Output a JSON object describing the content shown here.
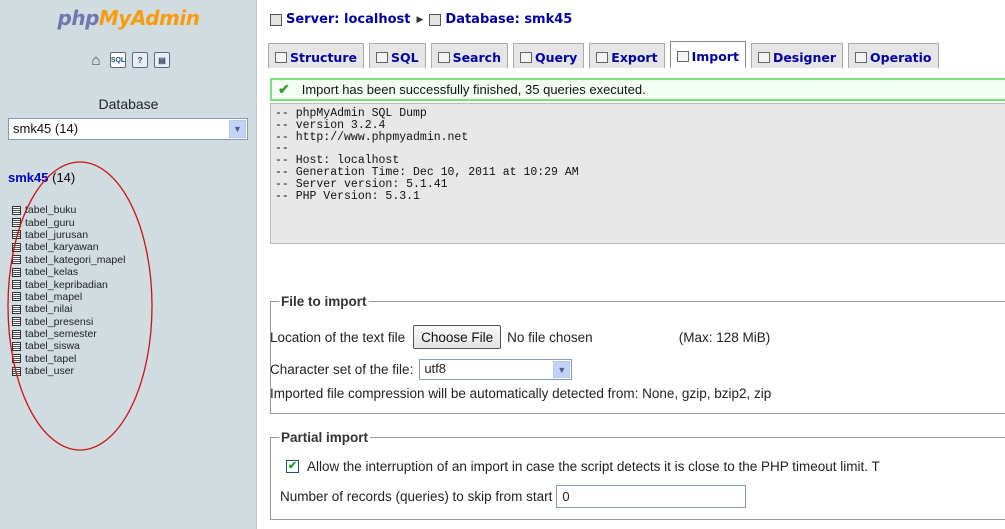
{
  "logo": {
    "part1": "php",
    "part2": "MyAdmin"
  },
  "left": {
    "quick_icons": [
      "home-icon",
      "sql-query-icon",
      "docs-icon",
      "sql-docs-icon"
    ],
    "database_label": "Database",
    "database_select": "smk45 (14)",
    "db_name": "smk45",
    "db_count": "(14)",
    "tables": [
      "tabel_buku",
      "tabel_guru",
      "tabel_jurusan",
      "tabel_karyawan",
      "tabel_kategori_mapel",
      "tabel_kelas",
      "tabel_kepribadian",
      "tabel_mapel",
      "tabel_nilai",
      "tabel_presensi",
      "tabel_semester",
      "tabel_siswa",
      "tabel_tapel",
      "tabel_user"
    ]
  },
  "breadcrumb": {
    "server": "Server: localhost",
    "database": "Database: smk45"
  },
  "tabs": [
    "Structure",
    "SQL",
    "Search",
    "Query",
    "Export",
    "Import",
    "Designer",
    "Operatio"
  ],
  "active_tab": "Import",
  "success_message": "Import has been successfully finished, 35 queries executed.",
  "sql_dump": [
    "-- phpMyAdmin SQL Dump",
    "-- version 3.2.4",
    "-- http://www.phpmyadmin.net",
    "--",
    "-- Host: localhost",
    "-- Generation Time: Dec 10, 2011 at 10:29 AM",
    "-- Server version: 5.1.41",
    "-- PHP Version: 5.3.1"
  ],
  "file_import": {
    "legend": "File to import",
    "location_label": "Location of the text file",
    "choose_button": "Choose File",
    "no_file": "No file chosen",
    "max_size": "(Max: 128 MiB)",
    "charset_label": "Character set of the file:",
    "charset_value": "utf8",
    "compression_note": "Imported file compression will be automatically detected from: None, gzip, bzip2, zip"
  },
  "partial_import": {
    "legend": "Partial import",
    "allow_interrupt_label": "Allow the interruption of an import in case the script detects it is close to the PHP timeout limit. T",
    "allow_interrupt_checked": true,
    "skip_label": "Number of records (queries) to skip from start",
    "skip_value": "0"
  },
  "colors": {
    "left_bg": "#d0dce0",
    "link": "#0000aa",
    "success_border": "#7fe07f",
    "annotation": "#d01010"
  }
}
